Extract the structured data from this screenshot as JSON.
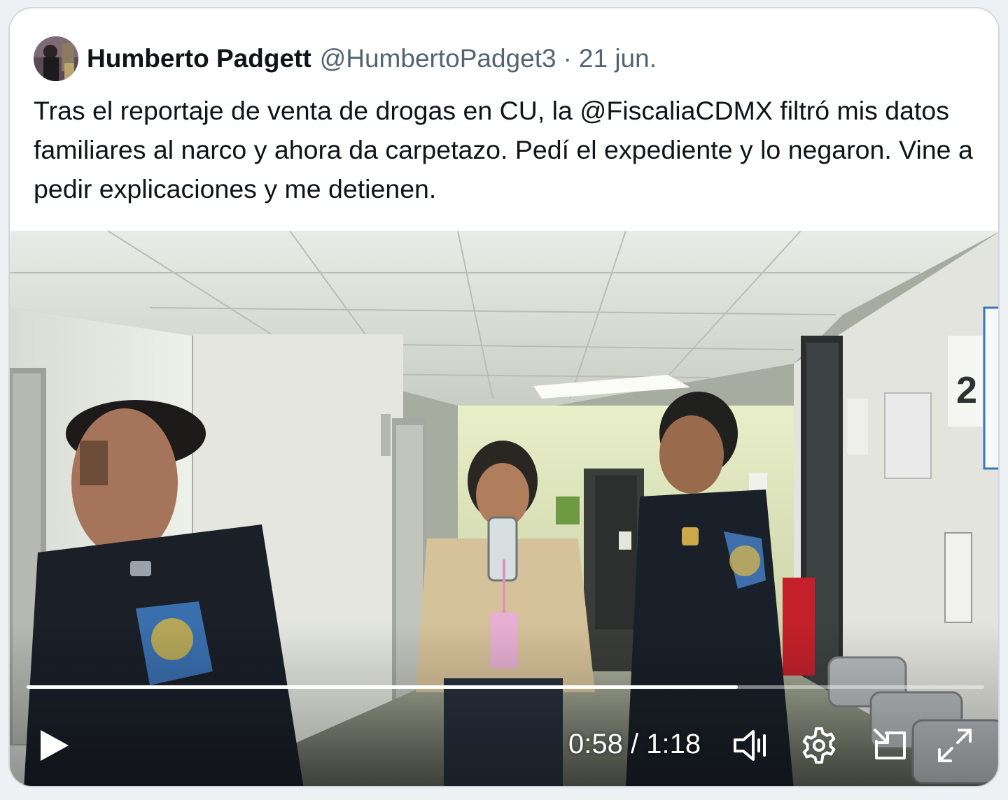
{
  "tweet": {
    "author": {
      "display_name": "Humberto Padgett",
      "handle": "@HumbertoPadget3"
    },
    "separator": "·",
    "date": "21 jun.",
    "text": "Tras el reportaje de venta de drogas en CU, la @FiscaliaCDMX filtró mis datos familiares al narco y ahora da carpetazo. Pedí el expediente y lo negaron. Vine a pedir explicaciones y me detienen."
  },
  "video": {
    "current_time": "0:58",
    "time_separator": "/",
    "duration": "1:18",
    "progress_fraction": 0.743,
    "controls": {
      "play": "play-icon",
      "volume": "volume-icon",
      "settings": "gear-icon",
      "pip": "picture-in-picture-icon",
      "fullscreen": "fullscreen-icon"
    },
    "scene_signage": {
      "floor_sign": "2"
    }
  },
  "colors": {
    "text_primary": "#0f1419",
    "text_secondary": "#536471",
    "card_border": "#cfd9de",
    "controls": "#ffffff"
  }
}
